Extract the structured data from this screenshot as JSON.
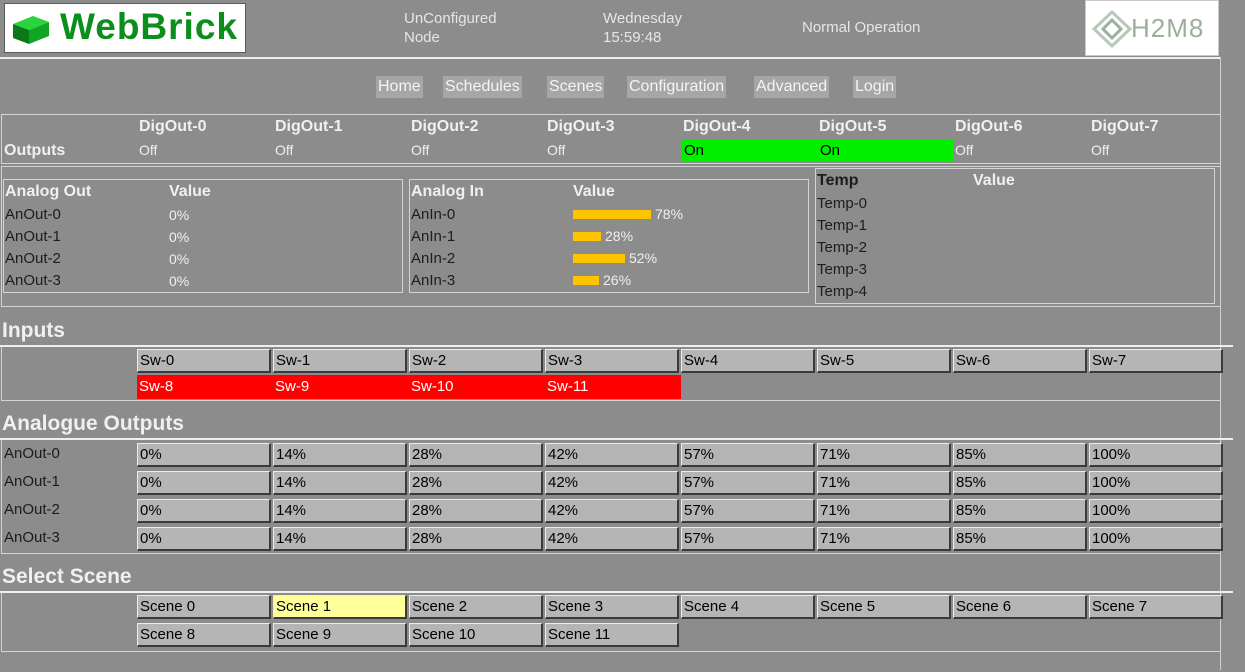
{
  "header": {
    "logo_text": "WebBrick",
    "node_line1": "UnConfigured",
    "node_line2": "Node",
    "day": "Wednesday",
    "time": "15:59:48",
    "status": "Normal Operation",
    "brand": "H2M8"
  },
  "nav": [
    "Home",
    "Schedules",
    "Scenes",
    "Configuration",
    "Advanced",
    "Login"
  ],
  "outputs": {
    "label": "Outputs",
    "items": [
      {
        "name": "DigOut-0",
        "state": "Off"
      },
      {
        "name": "DigOut-1",
        "state": "Off"
      },
      {
        "name": "DigOut-2",
        "state": "Off"
      },
      {
        "name": "DigOut-3",
        "state": "Off"
      },
      {
        "name": "DigOut-4",
        "state": "On"
      },
      {
        "name": "DigOut-5",
        "state": "On"
      },
      {
        "name": "DigOut-6",
        "state": "Off"
      },
      {
        "name": "DigOut-7",
        "state": "Off"
      }
    ]
  },
  "analog_out": {
    "header": "Analog Out",
    "value_header": "Value",
    "rows": [
      {
        "name": "AnOut-0",
        "value": "0%"
      },
      {
        "name": "AnOut-1",
        "value": "0%"
      },
      {
        "name": "AnOut-2",
        "value": "0%"
      },
      {
        "name": "AnOut-3",
        "value": "0%"
      }
    ]
  },
  "analog_in": {
    "header": "Analog In",
    "value_header": "Value",
    "rows": [
      {
        "name": "AnIn-0",
        "value": "78%",
        "level": 78
      },
      {
        "name": "AnIn-1",
        "value": "28%",
        "level": 28
      },
      {
        "name": "AnIn-2",
        "value": "52%",
        "level": 52
      },
      {
        "name": "AnIn-3",
        "value": "26%",
        "level": 26
      }
    ]
  },
  "temp": {
    "header": "Temp",
    "value_header": "Value",
    "rows": [
      "Temp-0",
      "Temp-1",
      "Temp-2",
      "Temp-3",
      "Temp-4"
    ]
  },
  "inputs": {
    "title": "Inputs",
    "row1": [
      "Sw-0",
      "Sw-1",
      "Sw-2",
      "Sw-3",
      "Sw-4",
      "Sw-5",
      "Sw-6",
      "Sw-7"
    ],
    "row2": [
      "Sw-8",
      "Sw-9",
      "Sw-10",
      "Sw-11"
    ]
  },
  "analogue_outputs": {
    "title": "Analogue Outputs",
    "rows": [
      "AnOut-0",
      "AnOut-1",
      "AnOut-2",
      "AnOut-3"
    ],
    "levels": [
      "0%",
      "14%",
      "28%",
      "42%",
      "57%",
      "71%",
      "85%",
      "100%"
    ]
  },
  "scenes": {
    "title": "Select Scene",
    "row1": [
      "Scene 0",
      "Scene 1",
      "Scene 2",
      "Scene 3",
      "Scene 4",
      "Scene 5",
      "Scene 6",
      "Scene 7"
    ],
    "row2": [
      "Scene 8",
      "Scene 9",
      "Scene 10",
      "Scene 11"
    ],
    "selected": "Scene 1"
  },
  "colors": {
    "background": "#8c8c8c",
    "on": "#00f000",
    "switch_active": "#ff0000",
    "bar": "#ffc400",
    "scene_selected": "#ffff99",
    "logo_green": "#0b8e1c"
  }
}
